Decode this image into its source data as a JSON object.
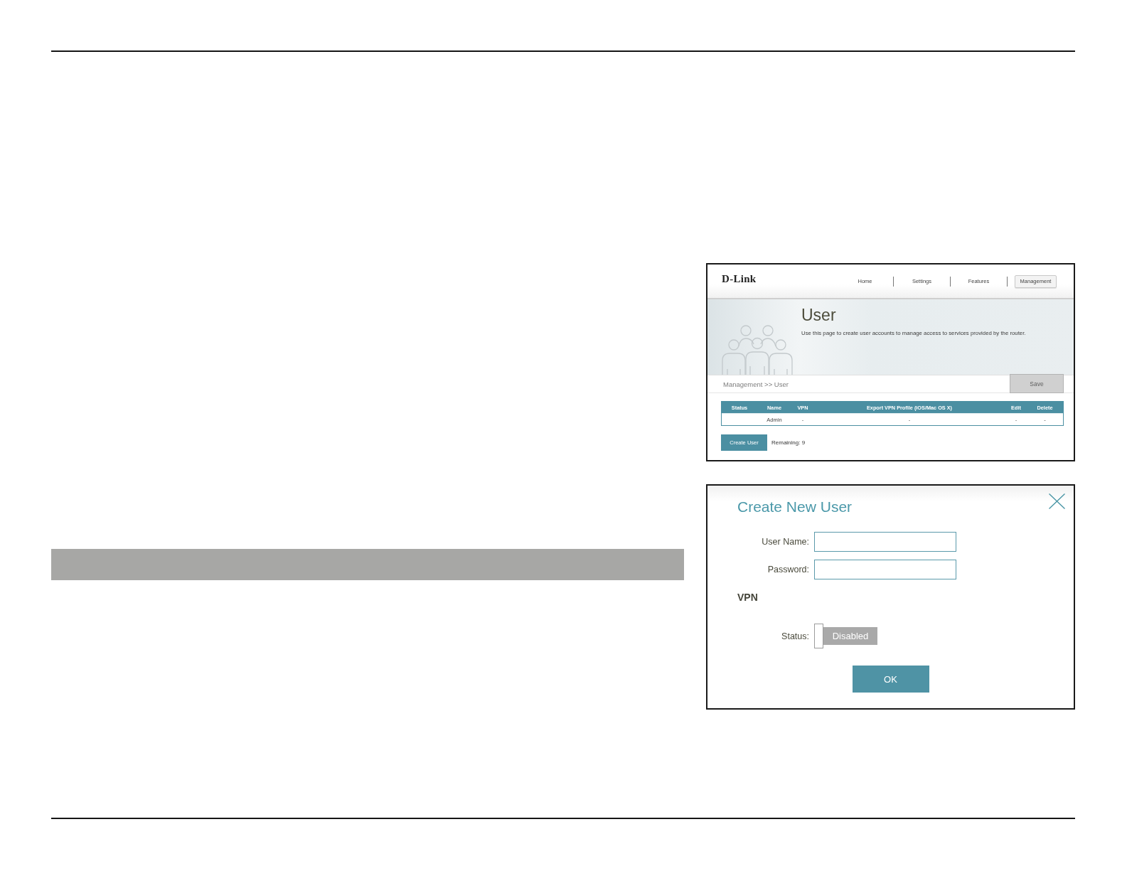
{
  "router_screenshot": {
    "logo": "D-Link",
    "nav": [
      {
        "label": "Home",
        "selected": false
      },
      {
        "label": "Settings",
        "selected": false
      },
      {
        "label": "Features",
        "selected": false
      },
      {
        "label": "Management",
        "selected": true
      }
    ],
    "title": "User",
    "description": "Use this page to create user accounts to manage access to services provided by the router.",
    "breadcrumb": "Management >> User",
    "save_button": {
      "label": "Save",
      "disabled": true
    },
    "table": {
      "columns": [
        "Status",
        "Name",
        "VPN",
        "Export VPN Profile (iOS/Mac OS X)",
        "Edit",
        "Delete"
      ],
      "rows": [
        {
          "name": "Admin",
          "vpn": "-",
          "export_vpn_profile": "-",
          "edit": "-",
          "delete": "-"
        }
      ]
    },
    "create_button": "Create User",
    "remaining": "Remaining: 9"
  },
  "dialog_screenshot": {
    "title": "Create New User",
    "fields": [
      {
        "label": "User Name:"
      },
      {
        "label": "Password:"
      }
    ],
    "section_title": "VPN",
    "vpn_status": {
      "label": "Status:",
      "on": false,
      "state_text": "Disabled"
    },
    "ok_button": "OK"
  }
}
